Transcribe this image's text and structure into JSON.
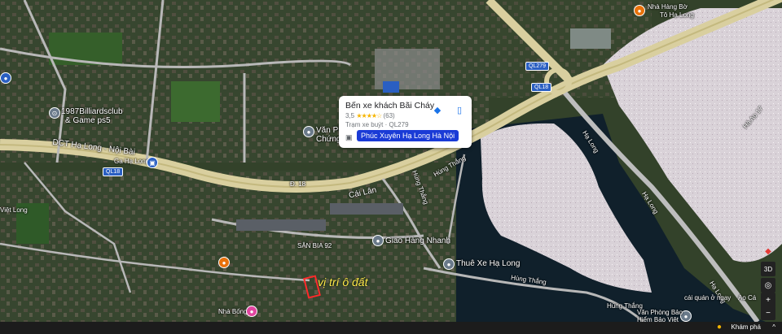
{
  "place_card": {
    "title": "Bến xe khách Bãi Cháy",
    "rating_value": "3,5",
    "stars": "★★★★☆",
    "reviews": "(63)",
    "type": "Trạm xe buýt · QL279",
    "route_label": "Phúc Xuyên Hạ Long Hà Nội",
    "directions_icon": "directions-icon",
    "save_icon": "bookmark-icon"
  },
  "labels": {
    "billiards": "1987Billiardsclub",
    "billiards2": "& Game ps5",
    "van_phong": "Văn Phòng",
    "chung": "Chứng",
    "dct": "DCT Hạ Long - Nội Bài",
    "ga_ha_long": "Ga Hạ Long",
    "d18": "Đ. 18",
    "cai_lan": "Cái Lân",
    "hung_thang1": "Hùng Thắng",
    "hung_thang2": "Hùng Thắng",
    "hung_thang3": "Hùng Thắng",
    "hung_thang4": "Hùng Thắng",
    "ha_long_road1": "Hạ Long",
    "ha_long_road2": "Hạ Long",
    "ha_long_road3": "Hạ Long",
    "san_bia": "SÂN BIA 92",
    "giao_hang": "Giao Hàng Nhanh",
    "thue_xe": "Thuê Xe Hạ Long",
    "nha_bong": "Nhà Bống",
    "van_phong_bao1": "Văn Phòng Bảo",
    "van_phong_bao2": "Hiểm Bảo Việt",
    "nha_hang1": "Nhà Hàng Bờ",
    "nha_hang2": "Tô Hạ Long",
    "viet_long": "Việt Long",
    "cai_quan": "cái quán ở ngay",
    "ao_ca": "Ao Cá",
    "qlaa": "Hà Ao 17",
    "qlbb": "Hạ Long",
    "vi_tri": "vị trí ô đất"
  },
  "shields": {
    "ql18a": "QL18",
    "ql18b": "QL18",
    "ql279a": "QL279",
    "ql18c": "QL18"
  },
  "controls": {
    "compass": "◆",
    "three_d": "3D",
    "locate": "◎",
    "zoom_in": "+",
    "zoom_out": "−"
  },
  "bottom_bar": {
    "explore": "Khám phá",
    "person_icon": "pegman-icon",
    "caret": "^"
  }
}
